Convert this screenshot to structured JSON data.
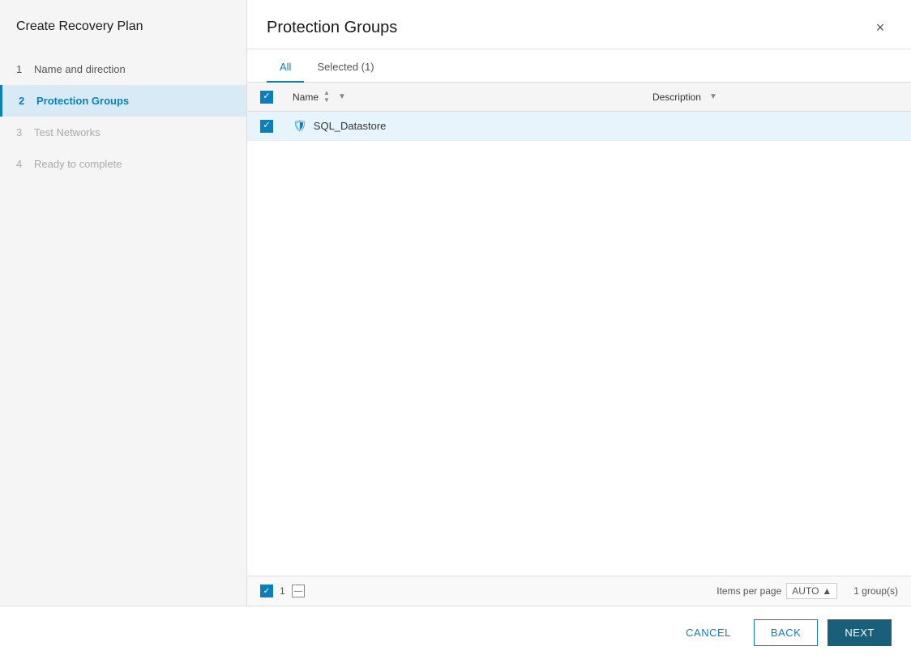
{
  "sidebar": {
    "title": "Create Recovery Plan",
    "steps": [
      {
        "id": 1,
        "label": "Name and direction",
        "state": "completed"
      },
      {
        "id": 2,
        "label": "Protection Groups",
        "state": "active"
      },
      {
        "id": 3,
        "label": "Test Networks",
        "state": "inactive"
      },
      {
        "id": 4,
        "label": "Ready to complete",
        "state": "inactive"
      }
    ]
  },
  "main": {
    "title": "Protection Groups",
    "close_label": "×",
    "tabs": [
      {
        "id": "all",
        "label": "All"
      },
      {
        "id": "selected",
        "label": "Selected (1)"
      }
    ],
    "table": {
      "columns": [
        {
          "id": "checkbox",
          "label": ""
        },
        {
          "id": "name",
          "label": "Name"
        },
        {
          "id": "description",
          "label": "Description"
        }
      ],
      "rows": [
        {
          "id": 1,
          "name": "SQL_Datastore",
          "description": "",
          "selected": true
        }
      ]
    },
    "footer": {
      "items_per_page_label": "Items per page",
      "per_page_value": "AUTO",
      "groups_count": "1 group(s)",
      "selected_count": "1"
    }
  },
  "buttons": {
    "cancel": "CANCEL",
    "back": "BACK",
    "next": "NEXT"
  }
}
